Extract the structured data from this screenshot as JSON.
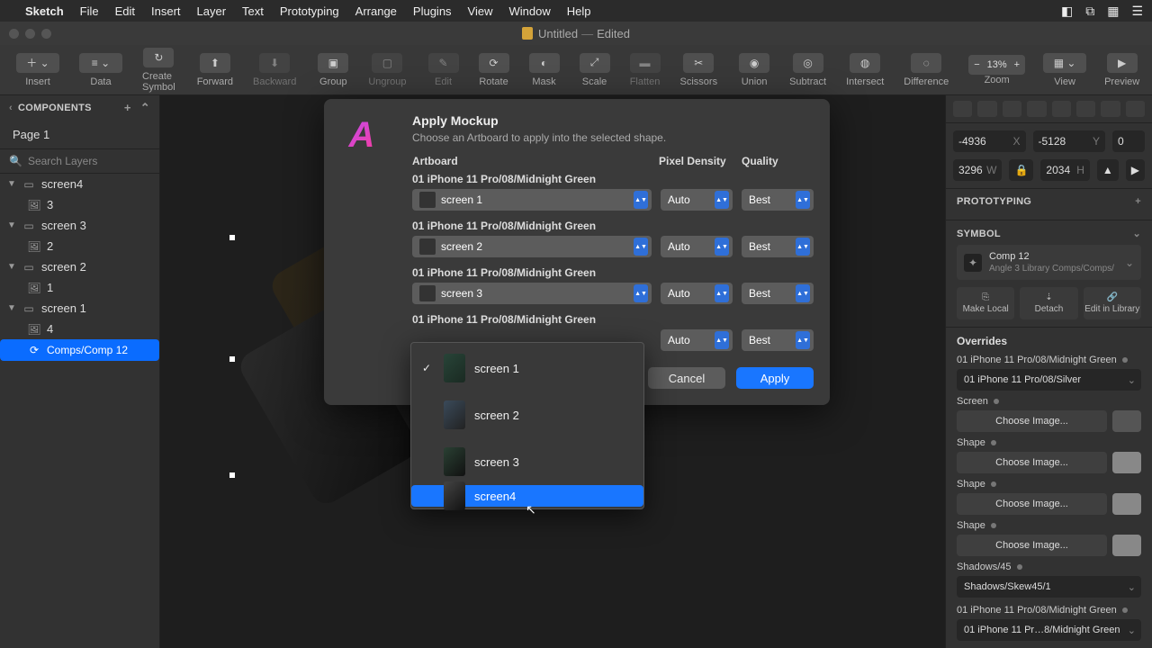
{
  "menubar": {
    "app": "Sketch",
    "items": [
      "File",
      "Edit",
      "Insert",
      "Layer",
      "Text",
      "Prototyping",
      "Arrange",
      "Plugins",
      "View",
      "Window",
      "Help"
    ]
  },
  "window": {
    "title": "Untitled",
    "state": "Edited"
  },
  "toolbar": {
    "insert": "Insert",
    "data": "Data",
    "create_symbol": "Create Symbol",
    "forward": "Forward",
    "backward": "Backward",
    "group": "Group",
    "ungroup": "Ungroup",
    "edit": "Edit",
    "rotate": "Rotate",
    "mask": "Mask",
    "scale": "Scale",
    "flatten": "Flatten",
    "scissors": "Scissors",
    "union": "Union",
    "subtract": "Subtract",
    "intersect": "Intersect",
    "difference": "Difference",
    "zoom": "Zoom",
    "zoom_value": "13%",
    "view": "View",
    "preview": "Preview"
  },
  "left": {
    "panel": "COMPONENTS",
    "page": "Page 1",
    "search": "Search Layers",
    "layers": [
      {
        "name": "screen4",
        "type": "artboard",
        "children": [
          {
            "name": "3",
            "type": "image"
          }
        ]
      },
      {
        "name": "screen 3",
        "type": "artboard",
        "children": [
          {
            "name": "2",
            "type": "image"
          }
        ]
      },
      {
        "name": "screen 2",
        "type": "artboard",
        "children": [
          {
            "name": "1",
            "type": "image"
          }
        ]
      },
      {
        "name": "screen 1",
        "type": "artboard",
        "children": [
          {
            "name": "4",
            "type": "image"
          },
          {
            "name": "Comps/Comp 12",
            "type": "symbol",
            "selected": true
          }
        ]
      }
    ]
  },
  "inspector": {
    "x": "-4936",
    "y": "-5128",
    "rot": "0",
    "w": "3296",
    "h": "2034",
    "proto": "PROTOTYPING",
    "symbol": "SYMBOL",
    "symbol_name": "Comp 12",
    "symbol_path": "Angle 3 Library Comps/Comps/",
    "make_local": "Make Local",
    "detach": "Detach",
    "edit_in_library": "Edit in Library",
    "overrides": "Overrides",
    "ovr_title1": "01 iPhone 11 Pro/08/Midnight Green",
    "ovr_sel1": "01 iPhone 11 Pro/08/Silver",
    "screen": "Screen",
    "shape": "Shape",
    "choose_image": "Choose Image...",
    "shadows": "Shadows/45",
    "shadows_sel": "Shadows/Skew45/1",
    "ovr_title2": "01 iPhone 11 Pro/08/Midnight Green",
    "ovr_sel2": "01 iPhone 11 Pr…8/Midnight Green"
  },
  "modal": {
    "title": "Apply Mockup",
    "subtitle": "Choose an Artboard to apply into the selected shape.",
    "col_artboard": "Artboard",
    "col_density": "Pixel Density",
    "col_quality": "Quality",
    "row_title": "01 iPhone 11 Pro/08/Midnight Green",
    "rows": [
      {
        "artboard": "screen 1",
        "density": "Auto",
        "quality": "Best"
      },
      {
        "artboard": "screen 2",
        "density": "Auto",
        "quality": "Best"
      },
      {
        "artboard": "screen 3",
        "density": "Auto",
        "quality": "Best"
      },
      {
        "artboard": "screen 1",
        "density": "Auto",
        "quality": "Best"
      }
    ],
    "cancel": "Cancel",
    "apply": "Apply"
  },
  "dropdown": {
    "items": [
      {
        "label": "screen 1",
        "checked": true
      },
      {
        "label": "screen 2"
      },
      {
        "label": "screen 3"
      },
      {
        "label": "screen4",
        "selected": true
      }
    ]
  }
}
